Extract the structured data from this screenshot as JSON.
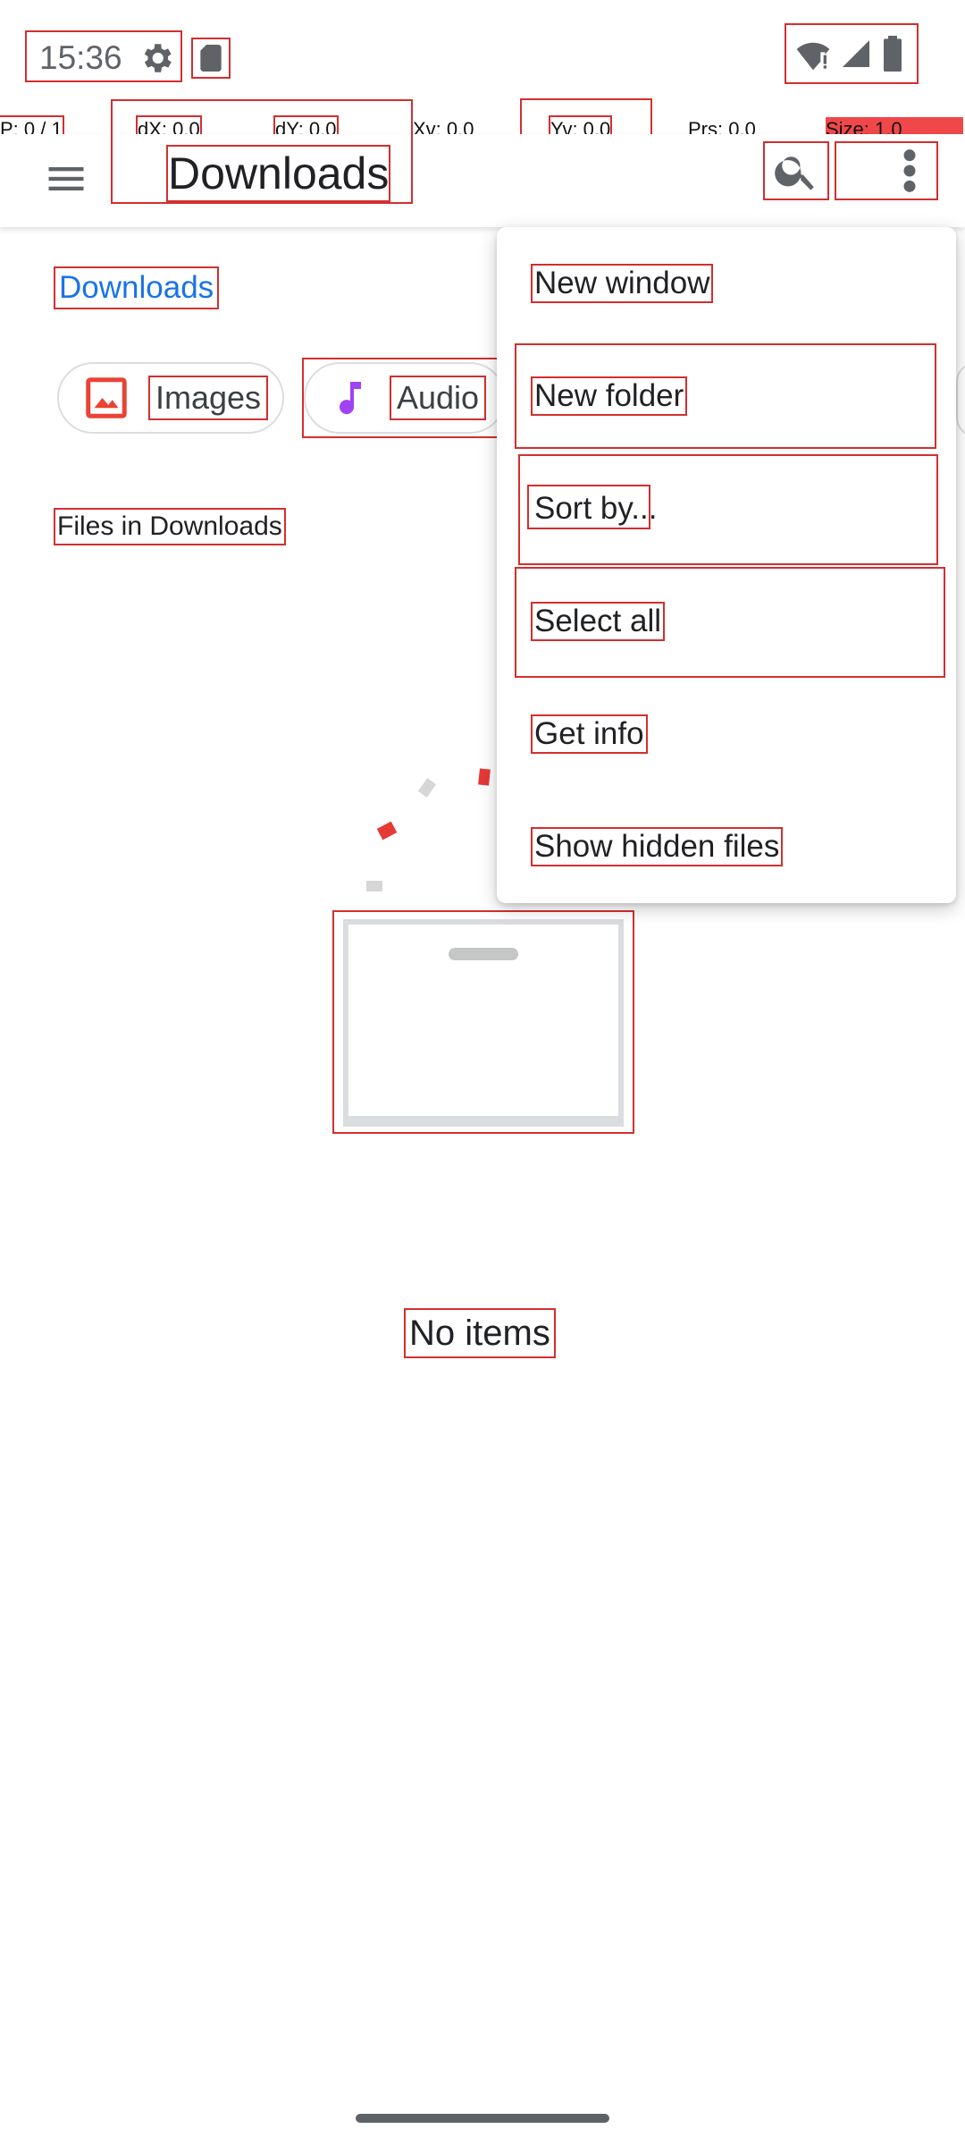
{
  "status_bar": {
    "time": "15:36",
    "icons": [
      "gear-icon",
      "sd-card-icon",
      "wifi-icon",
      "signal-icon",
      "battery-icon"
    ]
  },
  "pointer_overlay": {
    "p": "P: 0 / 1",
    "dx": "dX: 0.0",
    "dy": "dY: 0.0",
    "xv": "Xv: 0.0",
    "yv": "Yv: 0.0",
    "prs": "Prs: 0.0",
    "size": "Size: 1.0"
  },
  "app_bar": {
    "title": "Downloads",
    "icons": [
      "hamburger-menu-icon",
      "search-icon",
      "more-vert-icon"
    ]
  },
  "breadcrumb": "Downloads",
  "chips": [
    {
      "label": "Images",
      "icon": "image-icon",
      "color": "#ea4335"
    },
    {
      "label": "Audio",
      "icon": "music-note-icon",
      "color": "#a142f4"
    }
  ],
  "section_label": "Files in Downloads",
  "empty_state": {
    "message": "No items"
  },
  "overflow_menu": {
    "items": [
      {
        "label": "New window"
      },
      {
        "label": "New folder"
      },
      {
        "label": "Sort by..."
      },
      {
        "label": "Select all"
      },
      {
        "label": "Get info"
      },
      {
        "label": "Show hidden files"
      }
    ]
  },
  "colors": {
    "accent": "#1a73e8",
    "highlight_red": "#d32f2f",
    "images_red": "#ea4335",
    "audio_purple": "#a142f4"
  }
}
